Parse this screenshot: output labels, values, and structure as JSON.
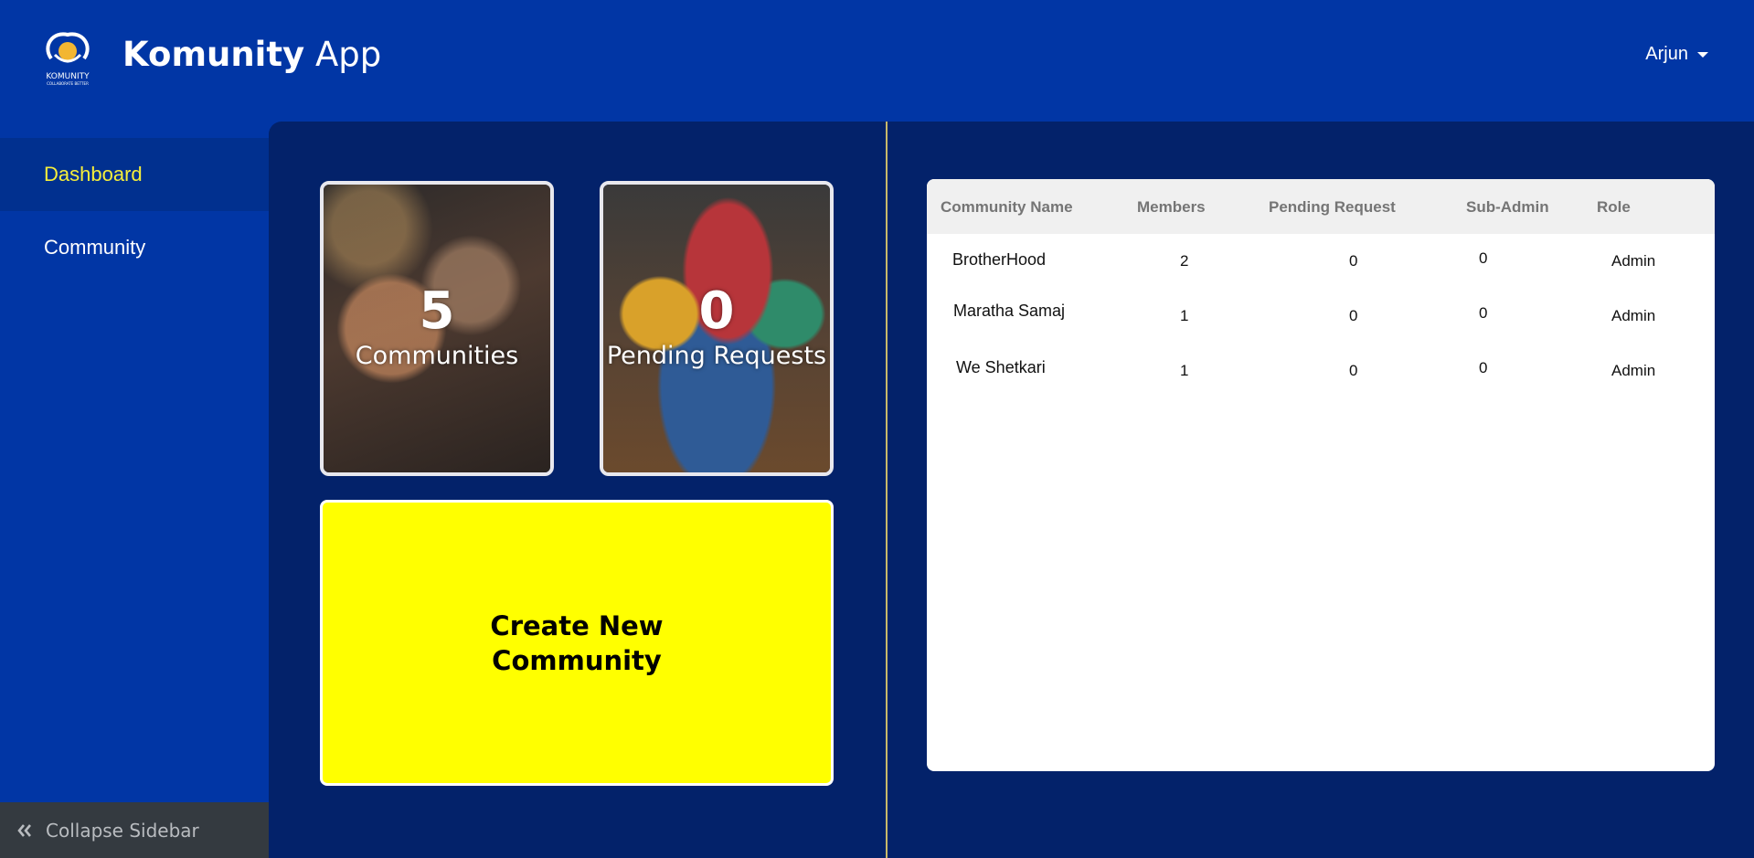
{
  "header": {
    "logo_text": "KOMUNITY",
    "logo_tagline": "COLLABORATE BETTER",
    "brand_bold": "Komunity",
    "brand_light": "App",
    "user_name": "Arjun"
  },
  "sidebar": {
    "items": [
      {
        "label": "Dashboard",
        "active": true
      },
      {
        "label": "Community",
        "active": false
      }
    ],
    "collapse_label": "Collapse Sidebar"
  },
  "stats": [
    {
      "value": "5",
      "label": "Communities"
    },
    {
      "value": "0",
      "label": "Pending Requests"
    }
  ],
  "create": {
    "line1": "Create New",
    "line2": "Community"
  },
  "table": {
    "columns": [
      "Community Name",
      "Members",
      "Pending Request",
      "Sub-Admin",
      "Role"
    ],
    "rows": [
      [
        "BrotherHood",
        "2",
        "0",
        "0",
        "Admin"
      ],
      [
        "Maratha Samaj",
        "1",
        "0",
        "0",
        "Admin"
      ],
      [
        "We Shetkari",
        "1",
        "0",
        "0",
        "Admin"
      ]
    ]
  },
  "colors": {
    "primary": "#0136a5",
    "main_bg": "#03226a",
    "active_text": "#f6ee3b",
    "create_bg": "#ffff00"
  }
}
